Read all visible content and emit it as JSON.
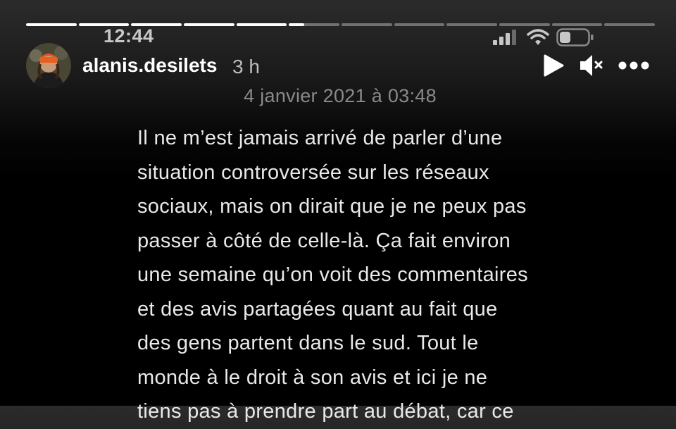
{
  "story": {
    "progress_segments": [
      1,
      1,
      1,
      1,
      1,
      0.3,
      0,
      0,
      0,
      0,
      0,
      0
    ]
  },
  "status_bar": {
    "time": "12:44",
    "icons": [
      "signal-icon",
      "wifi-icon",
      "battery-icon"
    ],
    "battery_level": 0.4
  },
  "header": {
    "avatar_icon": "avatar",
    "username": "alanis.desilets",
    "time_ago": "3 h",
    "controls": [
      "play-icon",
      "mute-icon",
      "more-options-icon"
    ]
  },
  "note": {
    "date": "4 janvier 2021 à 03:48",
    "lines": [
      "Il ne m’est jamais arrivé de parler d’une",
      "situation controversée sur les réseaux",
      "sociaux, mais on dirait que je ne peux pas",
      "passer à côté de celle-là. Ça fait environ",
      "une semaine qu’on voit des commentaires",
      "et des avis partagées quant au fait que",
      "des gens partent dans le sud. Tout le",
      "monde à le droit à son avis et ici je ne",
      "tiens pas à prendre part au débat, car ce"
    ]
  }
}
